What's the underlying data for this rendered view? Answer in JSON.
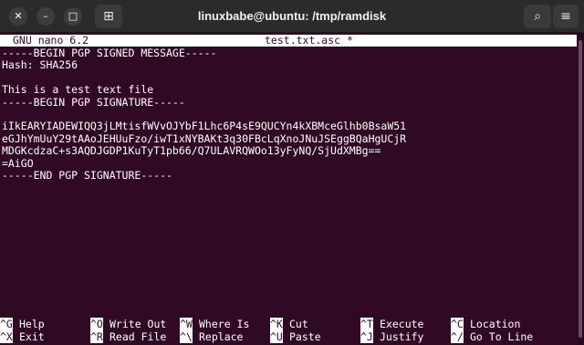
{
  "window": {
    "title": "linuxbabe@ubuntu: /tmp/ramdisk",
    "buttons": {
      "close": "✕",
      "minimize": "–",
      "maximize": "□"
    },
    "toolbar": {
      "new_tab": "⊞",
      "search": "⌕",
      "menu": "≡"
    }
  },
  "nano": {
    "version": "GNU nano 6.2",
    "filename": "test.txt.asc *",
    "lines": [
      "-----BEGIN PGP SIGNED MESSAGE-----",
      "Hash: SHA256",
      "",
      "This is a test text file",
      "-----BEGIN PGP SIGNATURE-----",
      "",
      "iIkEARYIADEWIQQ3jLMtisfWVvOJYbF1Lhc6P4sE9QUCYn4kXBMceGlhb0BsaW51",
      "eGJhYmUuY29tAAoJEHUuFzo/iwT1xNYBAKt3q30FBcLqXnoJNuJSEggBQaHgUCjR",
      "MDGKcdzaC+s3AQDJGDP1KuTyT1pb66/Q7ULAVRQWOo13yFyNQ/SjUdXMBg==",
      "=AiGO",
      "-----END PGP SIGNATURE-----"
    ],
    "shortcuts_row1": [
      {
        "key": "^G",
        "label": "Help"
      },
      {
        "key": "^O",
        "label": "Write Out"
      },
      {
        "key": "^W",
        "label": "Where Is"
      },
      {
        "key": "^K",
        "label": "Cut"
      },
      {
        "key": "^T",
        "label": "Execute"
      },
      {
        "key": "^C",
        "label": "Location"
      }
    ],
    "shortcuts_row2": [
      {
        "key": "^X",
        "label": "Exit"
      },
      {
        "key": "^R",
        "label": "Read File"
      },
      {
        "key": "^\\",
        "label": "Replace"
      },
      {
        "key": "^U",
        "label": "Paste"
      },
      {
        "key": "^J",
        "label": "Justify"
      },
      {
        "key": "^/",
        "label": "Go To Line"
      }
    ]
  },
  "colors": {
    "terminal_bg": "#300a24",
    "terminal_fg": "#ffffff",
    "titlebar_bg": "#2b2b2b"
  }
}
